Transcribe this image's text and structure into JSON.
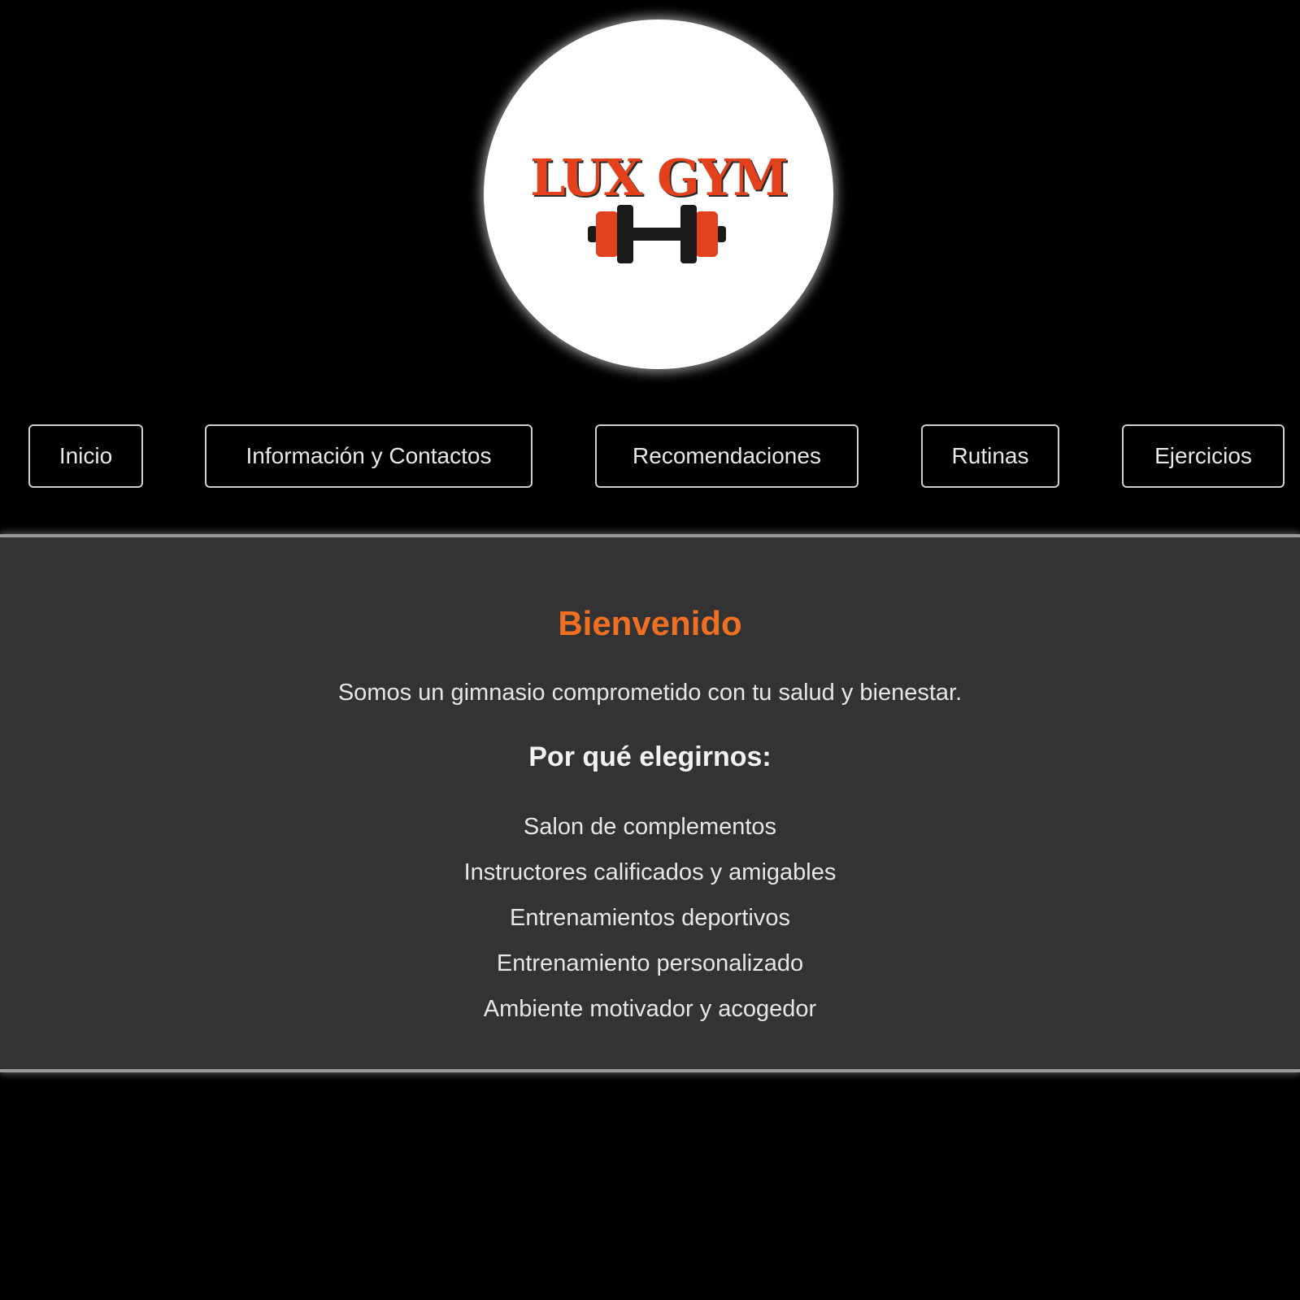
{
  "logo": {
    "text": "LUX GYM",
    "icon": "dumbbell-icon",
    "colors": {
      "text": "#e2411c",
      "plates": "#e2411c",
      "bar": "#1a1a1a",
      "background": "#ffffff"
    }
  },
  "nav": {
    "items": [
      {
        "label": "Inicio"
      },
      {
        "label": "Información y Contactos"
      },
      {
        "label": "Recomendaciones"
      },
      {
        "label": "Rutinas"
      },
      {
        "label": "Ejercicios"
      }
    ]
  },
  "main": {
    "title": "Bienvenido",
    "intro": "Somos un gimnasio comprometido con tu salud y bienestar.",
    "subtitle": "Por qué elegirnos:",
    "reasons": [
      "Salon de complementos",
      "Instructores calificados y amigables",
      "Entrenamientos deportivos",
      "Entrenamiento personalizado",
      "Ambiente motivador y acogedor"
    ]
  },
  "colors": {
    "page_background": "#000000",
    "section_background": "#333333",
    "accent": "#f07023",
    "nav_border": "#cfcfcf"
  }
}
